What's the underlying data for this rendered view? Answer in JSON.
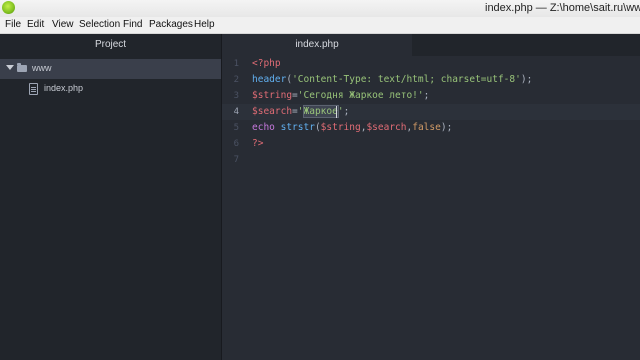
{
  "window": {
    "title": "index.php — Z:\\home\\sait.ru\\www"
  },
  "menu": [
    "File",
    "Edit",
    "View",
    "Selection",
    "Find",
    "Packages",
    "Help"
  ],
  "sidebar": {
    "title": "Project",
    "tree": [
      {
        "label": "www",
        "type": "folder"
      },
      {
        "label": "index.php",
        "type": "file"
      }
    ]
  },
  "tabs": [
    {
      "label": "index.php"
    }
  ],
  "editor": {
    "line_numbers": [
      "1",
      "2",
      "3",
      "4",
      "5",
      "6",
      "7"
    ],
    "active_line": 4,
    "lines": [
      [
        {
          "t": "<?php",
          "c": "t-tag"
        }
      ],
      [
        {
          "t": "header",
          "c": "t-func"
        },
        {
          "t": "(",
          "c": "t-punc"
        },
        {
          "t": "'Content-Type: text/html; charset=utf-8'",
          "c": "t-str"
        },
        {
          "t": ");",
          "c": "t-punc"
        }
      ],
      [
        {
          "t": "$string",
          "c": "t-var"
        },
        {
          "t": "=",
          "c": "t-punc"
        },
        {
          "t": "'Сегодня Жаркое лето!'",
          "c": "t-str"
        },
        {
          "t": ";",
          "c": "t-punc"
        }
      ],
      [
        {
          "t": "$search",
          "c": "t-var"
        },
        {
          "t": "=",
          "c": "t-punc"
        },
        {
          "t": "'",
          "c": "t-str"
        },
        {
          "t": "Жаркое",
          "c": "t-str sel"
        },
        {
          "t": "'",
          "c": "t-str"
        },
        {
          "t": ";",
          "c": "t-punc"
        }
      ],
      [
        {
          "t": "echo ",
          "c": "t-kw"
        },
        {
          "t": "strstr",
          "c": "t-func"
        },
        {
          "t": "(",
          "c": "t-punc"
        },
        {
          "t": "$string",
          "c": "t-var"
        },
        {
          "t": ",",
          "c": "t-punc"
        },
        {
          "t": "$search",
          "c": "t-var"
        },
        {
          "t": ",",
          "c": "t-punc"
        },
        {
          "t": "false",
          "c": "t-const"
        },
        {
          "t": ");",
          "c": "t-punc"
        }
      ],
      [
        {
          "t": "?>",
          "c": "t-tag"
        }
      ],
      []
    ]
  }
}
